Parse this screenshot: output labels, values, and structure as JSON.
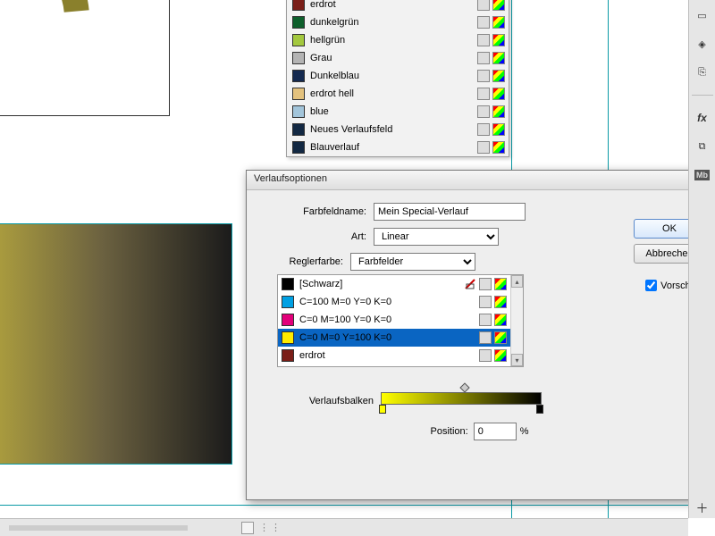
{
  "canvas": {},
  "swatches": [
    {
      "name": "erdrot",
      "color": "#7a1e18"
    },
    {
      "name": "dunkelgrün",
      "color": "#0d5f2b"
    },
    {
      "name": "hellgrün",
      "color": "#a3c83e"
    },
    {
      "name": "Grau",
      "color": "#b4b4b4"
    },
    {
      "name": "Dunkelblau",
      "color": "#14294f"
    },
    {
      "name": "erdrot hell",
      "color": "#e3c27e"
    },
    {
      "name": "blue",
      "color": "#a3c5da"
    },
    {
      "name": "Neues Verlaufsfeld",
      "color": "#122842"
    },
    {
      "name": "Blauverlauf",
      "color": "#122842"
    }
  ],
  "dialog": {
    "title": "Verlaufsoptionen",
    "labels": {
      "name": "Farbfeldname:",
      "type": "Art:",
      "stopcolor": "Reglerfarbe:",
      "gradbar": "Verlaufsbalken",
      "position": "Position:"
    },
    "name_value": "Mein Special-Verlauf",
    "type_value": "Linear",
    "stopcolor_value": "Farbfelder",
    "position_value": "0",
    "percent": "%",
    "buttons": {
      "ok": "OK",
      "cancel": "Abbrechen"
    },
    "preview_label": "Vorschau",
    "color_list": [
      {
        "name": "[Schwarz]",
        "color": "#000000",
        "locked": true
      },
      {
        "name": "C=100 M=0 Y=0 K=0",
        "color": "#00a0e3"
      },
      {
        "name": "C=0 M=100 Y=0 K=0",
        "color": "#e2007a"
      },
      {
        "name": "C=0 M=0 Y=100 K=0",
        "color": "#ffed00",
        "selected": true
      },
      {
        "name": "erdrot",
        "color": "#7a1e18"
      }
    ]
  },
  "toolbar_icons": {
    "doc": "▭",
    "layers": "◆",
    "links": "⎘",
    "fx": "fx",
    "clip": "⧉",
    "mb": "Mb",
    "plus": "＋"
  }
}
